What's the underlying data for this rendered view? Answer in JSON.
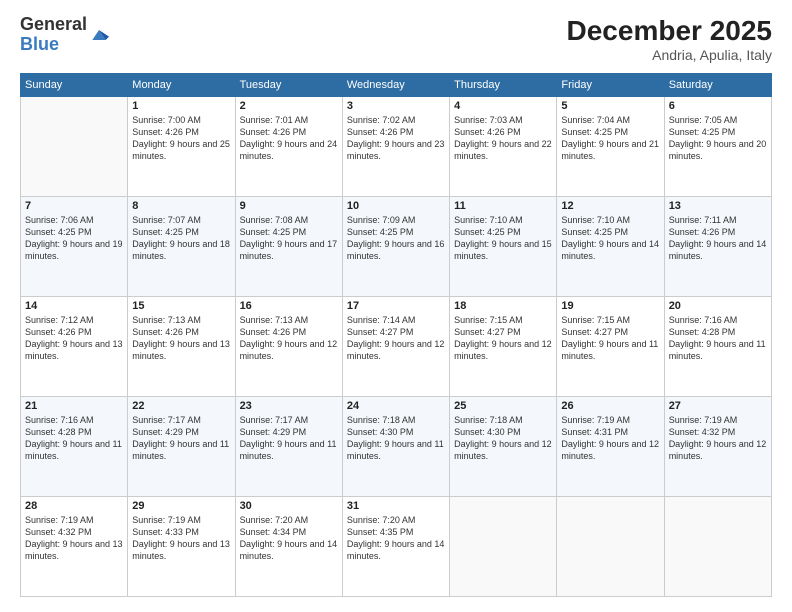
{
  "header": {
    "logo_general": "General",
    "logo_blue": "Blue",
    "month_title": "December 2025",
    "location": "Andria, Apulia, Italy"
  },
  "weekdays": [
    "Sunday",
    "Monday",
    "Tuesday",
    "Wednesday",
    "Thursday",
    "Friday",
    "Saturday"
  ],
  "weeks": [
    [
      {
        "day": "",
        "sunrise": "",
        "sunset": "",
        "daylight": ""
      },
      {
        "day": "1",
        "sunrise": "Sunrise: 7:00 AM",
        "sunset": "Sunset: 4:26 PM",
        "daylight": "Daylight: 9 hours and 25 minutes."
      },
      {
        "day": "2",
        "sunrise": "Sunrise: 7:01 AM",
        "sunset": "Sunset: 4:26 PM",
        "daylight": "Daylight: 9 hours and 24 minutes."
      },
      {
        "day": "3",
        "sunrise": "Sunrise: 7:02 AM",
        "sunset": "Sunset: 4:26 PM",
        "daylight": "Daylight: 9 hours and 23 minutes."
      },
      {
        "day": "4",
        "sunrise": "Sunrise: 7:03 AM",
        "sunset": "Sunset: 4:26 PM",
        "daylight": "Daylight: 9 hours and 22 minutes."
      },
      {
        "day": "5",
        "sunrise": "Sunrise: 7:04 AM",
        "sunset": "Sunset: 4:25 PM",
        "daylight": "Daylight: 9 hours and 21 minutes."
      },
      {
        "day": "6",
        "sunrise": "Sunrise: 7:05 AM",
        "sunset": "Sunset: 4:25 PM",
        "daylight": "Daylight: 9 hours and 20 minutes."
      }
    ],
    [
      {
        "day": "7",
        "sunrise": "Sunrise: 7:06 AM",
        "sunset": "Sunset: 4:25 PM",
        "daylight": "Daylight: 9 hours and 19 minutes."
      },
      {
        "day": "8",
        "sunrise": "Sunrise: 7:07 AM",
        "sunset": "Sunset: 4:25 PM",
        "daylight": "Daylight: 9 hours and 18 minutes."
      },
      {
        "day": "9",
        "sunrise": "Sunrise: 7:08 AM",
        "sunset": "Sunset: 4:25 PM",
        "daylight": "Daylight: 9 hours and 17 minutes."
      },
      {
        "day": "10",
        "sunrise": "Sunrise: 7:09 AM",
        "sunset": "Sunset: 4:25 PM",
        "daylight": "Daylight: 9 hours and 16 minutes."
      },
      {
        "day": "11",
        "sunrise": "Sunrise: 7:10 AM",
        "sunset": "Sunset: 4:25 PM",
        "daylight": "Daylight: 9 hours and 15 minutes."
      },
      {
        "day": "12",
        "sunrise": "Sunrise: 7:10 AM",
        "sunset": "Sunset: 4:25 PM",
        "daylight": "Daylight: 9 hours and 14 minutes."
      },
      {
        "day": "13",
        "sunrise": "Sunrise: 7:11 AM",
        "sunset": "Sunset: 4:26 PM",
        "daylight": "Daylight: 9 hours and 14 minutes."
      }
    ],
    [
      {
        "day": "14",
        "sunrise": "Sunrise: 7:12 AM",
        "sunset": "Sunset: 4:26 PM",
        "daylight": "Daylight: 9 hours and 13 minutes."
      },
      {
        "day": "15",
        "sunrise": "Sunrise: 7:13 AM",
        "sunset": "Sunset: 4:26 PM",
        "daylight": "Daylight: 9 hours and 13 minutes."
      },
      {
        "day": "16",
        "sunrise": "Sunrise: 7:13 AM",
        "sunset": "Sunset: 4:26 PM",
        "daylight": "Daylight: 9 hours and 12 minutes."
      },
      {
        "day": "17",
        "sunrise": "Sunrise: 7:14 AM",
        "sunset": "Sunset: 4:27 PM",
        "daylight": "Daylight: 9 hours and 12 minutes."
      },
      {
        "day": "18",
        "sunrise": "Sunrise: 7:15 AM",
        "sunset": "Sunset: 4:27 PM",
        "daylight": "Daylight: 9 hours and 12 minutes."
      },
      {
        "day": "19",
        "sunrise": "Sunrise: 7:15 AM",
        "sunset": "Sunset: 4:27 PM",
        "daylight": "Daylight: 9 hours and 11 minutes."
      },
      {
        "day": "20",
        "sunrise": "Sunrise: 7:16 AM",
        "sunset": "Sunset: 4:28 PM",
        "daylight": "Daylight: 9 hours and 11 minutes."
      }
    ],
    [
      {
        "day": "21",
        "sunrise": "Sunrise: 7:16 AM",
        "sunset": "Sunset: 4:28 PM",
        "daylight": "Daylight: 9 hours and 11 minutes."
      },
      {
        "day": "22",
        "sunrise": "Sunrise: 7:17 AM",
        "sunset": "Sunset: 4:29 PM",
        "daylight": "Daylight: 9 hours and 11 minutes."
      },
      {
        "day": "23",
        "sunrise": "Sunrise: 7:17 AM",
        "sunset": "Sunset: 4:29 PM",
        "daylight": "Daylight: 9 hours and 11 minutes."
      },
      {
        "day": "24",
        "sunrise": "Sunrise: 7:18 AM",
        "sunset": "Sunset: 4:30 PM",
        "daylight": "Daylight: 9 hours and 11 minutes."
      },
      {
        "day": "25",
        "sunrise": "Sunrise: 7:18 AM",
        "sunset": "Sunset: 4:30 PM",
        "daylight": "Daylight: 9 hours and 12 minutes."
      },
      {
        "day": "26",
        "sunrise": "Sunrise: 7:19 AM",
        "sunset": "Sunset: 4:31 PM",
        "daylight": "Daylight: 9 hours and 12 minutes."
      },
      {
        "day": "27",
        "sunrise": "Sunrise: 7:19 AM",
        "sunset": "Sunset: 4:32 PM",
        "daylight": "Daylight: 9 hours and 12 minutes."
      }
    ],
    [
      {
        "day": "28",
        "sunrise": "Sunrise: 7:19 AM",
        "sunset": "Sunset: 4:32 PM",
        "daylight": "Daylight: 9 hours and 13 minutes."
      },
      {
        "day": "29",
        "sunrise": "Sunrise: 7:19 AM",
        "sunset": "Sunset: 4:33 PM",
        "daylight": "Daylight: 9 hours and 13 minutes."
      },
      {
        "day": "30",
        "sunrise": "Sunrise: 7:20 AM",
        "sunset": "Sunset: 4:34 PM",
        "daylight": "Daylight: 9 hours and 14 minutes."
      },
      {
        "day": "31",
        "sunrise": "Sunrise: 7:20 AM",
        "sunset": "Sunset: 4:35 PM",
        "daylight": "Daylight: 9 hours and 14 minutes."
      },
      {
        "day": "",
        "sunrise": "",
        "sunset": "",
        "daylight": ""
      },
      {
        "day": "",
        "sunrise": "",
        "sunset": "",
        "daylight": ""
      },
      {
        "day": "",
        "sunrise": "",
        "sunset": "",
        "daylight": ""
      }
    ]
  ]
}
